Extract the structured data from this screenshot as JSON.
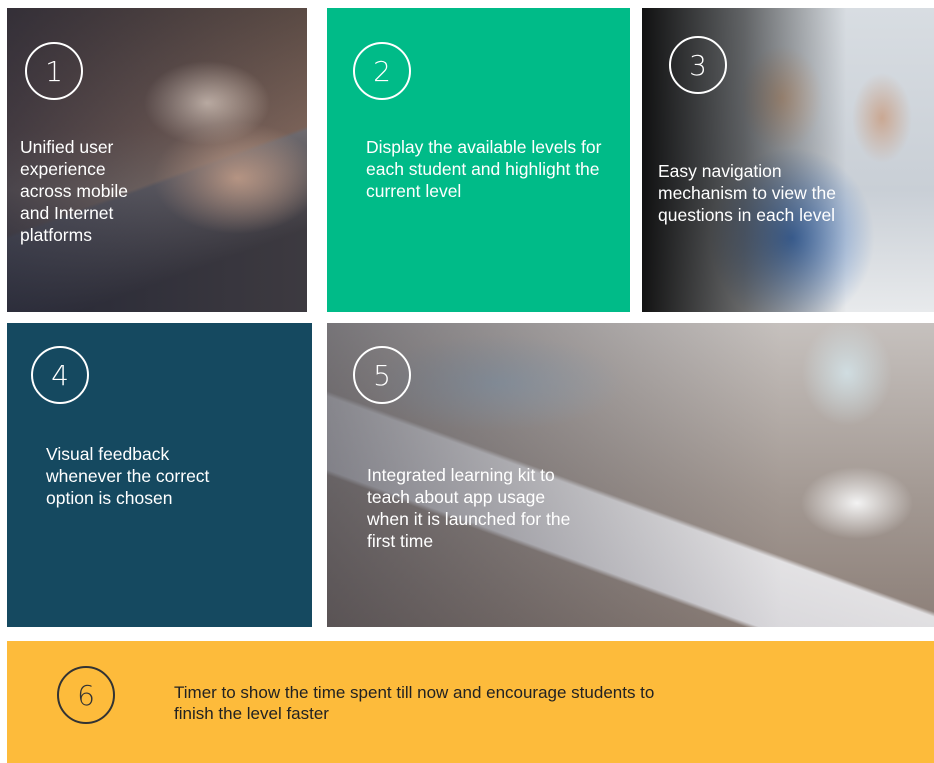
{
  "tiles": [
    {
      "number": "1",
      "text": "Unified user experience across mobile and Internet platforms"
    },
    {
      "number": "2",
      "text": "Display the available levels for each student and highlight the current level"
    },
    {
      "number": "3",
      "text": "Easy navigation mechanism to view the questions in each level"
    },
    {
      "number": "4",
      "text": "Visual feedback whenever the correct option is chosen"
    },
    {
      "number": "5",
      "text": "Integrated learning kit to teach about app usage when it is launched for the first time"
    },
    {
      "number": "6",
      "text": "Timer to show the time spent till now and encourage students to finish the level faster"
    }
  ],
  "colors": {
    "green": "#00bb88",
    "teal": "#154960",
    "yellow": "#fdbb3b",
    "circle_border_light": "#ffffff",
    "circle_border_dark": "#333333"
  }
}
